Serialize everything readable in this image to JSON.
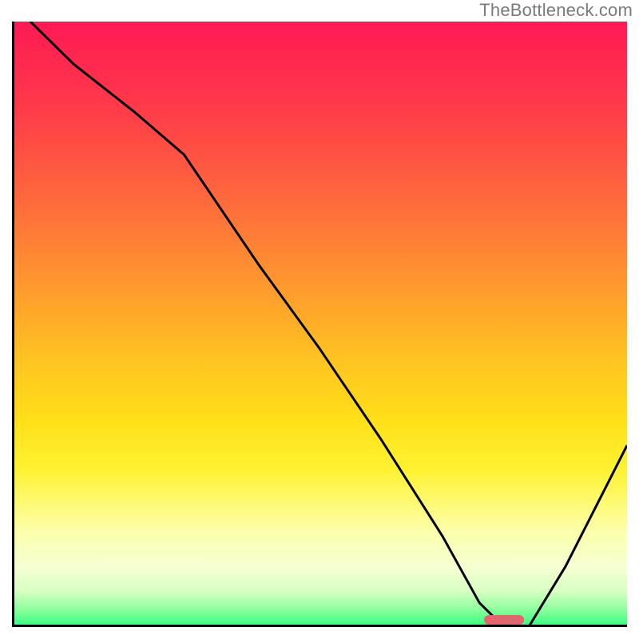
{
  "watermark": "TheBottleneck.com",
  "colors": {
    "axis": "#000000",
    "curve": "#000000",
    "marker": "#e06670"
  },
  "chart_data": {
    "type": "line",
    "title": "",
    "xlabel": "",
    "ylabel": "",
    "xlim": [
      0,
      100
    ],
    "ylim": [
      0,
      100
    ],
    "grid": false,
    "legend": false,
    "series": [
      {
        "name": "bottleneck-curve",
        "x": [
          3,
          10,
          20,
          28,
          40,
          50,
          60,
          70,
          76,
          80,
          84,
          90,
          100
        ],
        "values": [
          100,
          93,
          85,
          78,
          60,
          46,
          31,
          15,
          4,
          0,
          0,
          10,
          30
        ]
      }
    ],
    "annotations": [
      {
        "name": "optimal-marker",
        "x": 80,
        "y": 0.5,
        "width_pct": 6.5
      }
    ]
  }
}
